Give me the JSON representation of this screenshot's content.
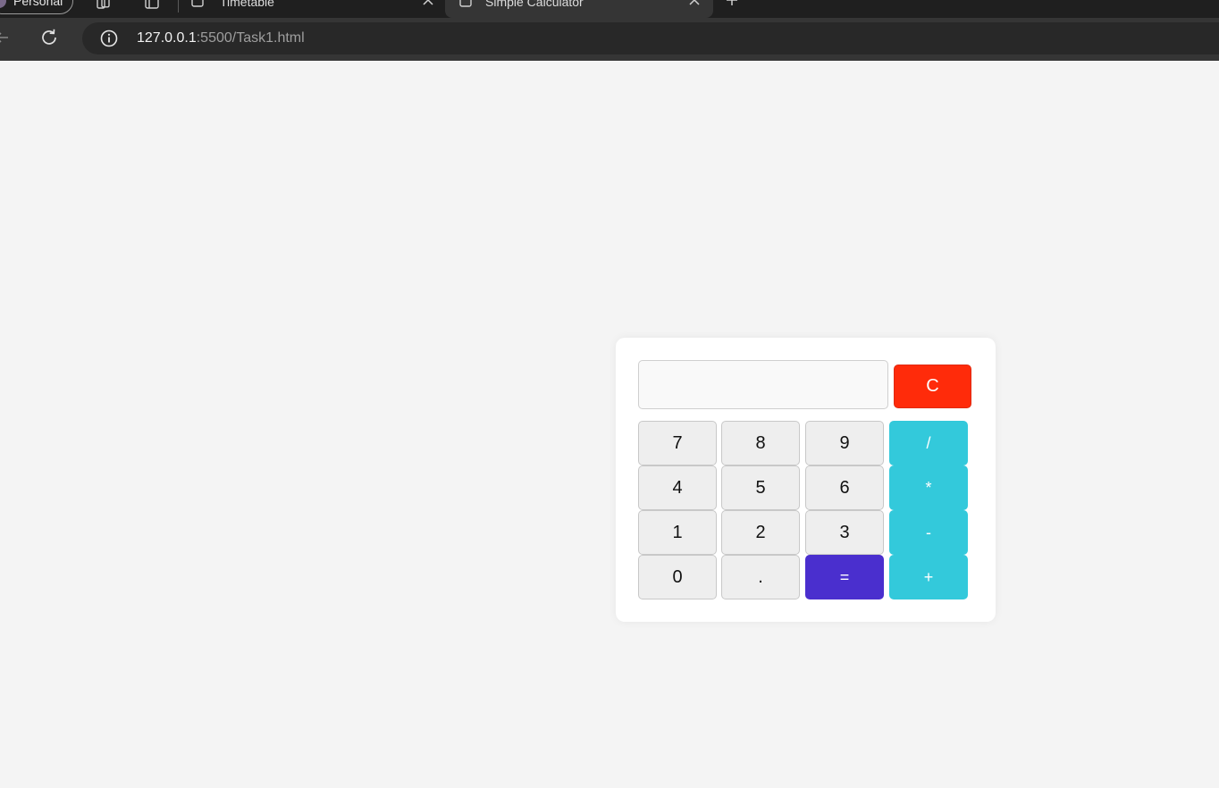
{
  "browser": {
    "profile_label": "Personal",
    "tabs": [
      {
        "title": "Timetable",
        "active": false
      },
      {
        "title": "Simple Calculator",
        "active": true
      }
    ],
    "url_host": "127.0.0.1",
    "url_rest": ":5500/Task1.html"
  },
  "calculator": {
    "display_value": "",
    "clear_label": "C",
    "buttons": {
      "seven": "7",
      "eight": "8",
      "nine": "9",
      "divide": "/",
      "four": "4",
      "five": "5",
      "six": "6",
      "multiply": "*",
      "one": "1",
      "two": "2",
      "three": "3",
      "subtract": "-",
      "zero": "0",
      "decimal": ".",
      "equals": "=",
      "add": "+"
    }
  },
  "colors": {
    "page_background": "#f4f4f4",
    "operator_button": "#33c9db",
    "equals_button": "#4a2fce",
    "clear_button": "#ff2b0a",
    "digit_button": "#eeeeee"
  }
}
